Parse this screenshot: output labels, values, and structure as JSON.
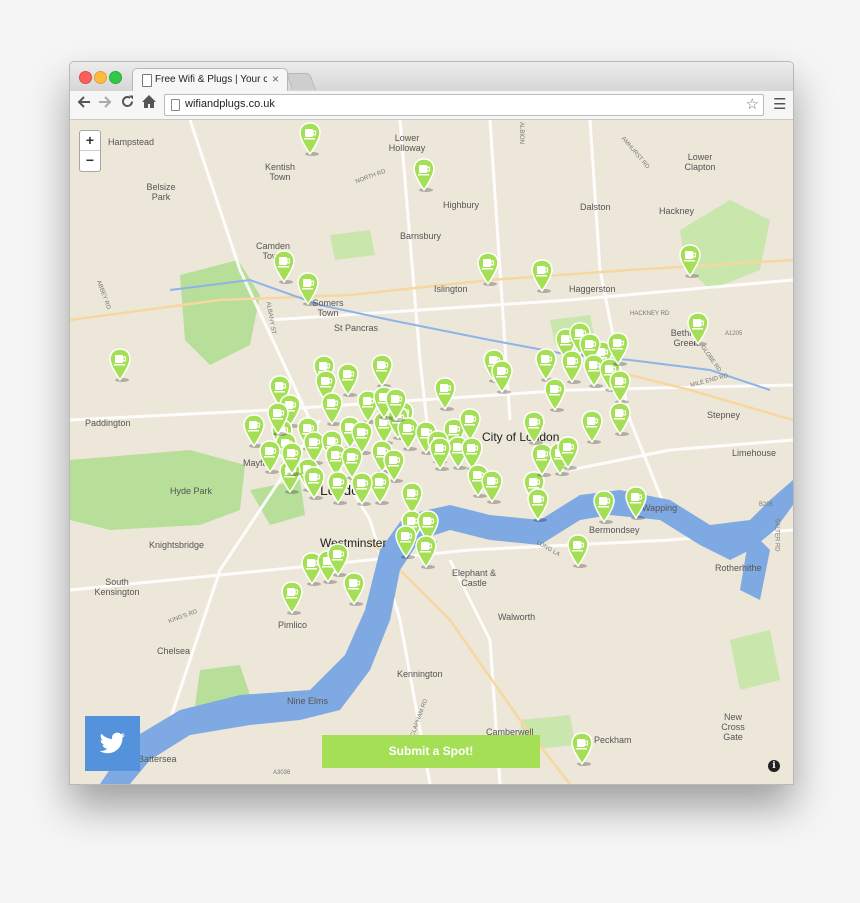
{
  "browser": {
    "tab_title": "Free Wifi & Plugs | Your co",
    "tab_close": "×",
    "url": "wifiandplugs.co.uk",
    "icons": [
      "back-arrow-icon",
      "forward-arrow-icon",
      "reload-icon",
      "home-icon",
      "page-icon",
      "bookmark-star-icon",
      "menu-icon"
    ]
  },
  "map": {
    "zoom_in": "+",
    "zoom_out": "−",
    "submit_label": "Submit a Spot!",
    "info": "i",
    "colors": {
      "park": "#b8df9a",
      "water": "#7fa9e3",
      "land": "#ede7da",
      "pin": "#a5df55",
      "twitter": "#5592dc"
    },
    "places": [
      {
        "name": "Hampstead",
        "size": "small"
      },
      {
        "name": "Kentish Town",
        "size": "small"
      },
      {
        "name": "Belsize Park",
        "size": "small"
      },
      {
        "name": "Camden Town",
        "size": "small"
      },
      {
        "name": "Highbury",
        "size": "small"
      },
      {
        "name": "Barnsbury",
        "size": "small"
      },
      {
        "name": "Dalston",
        "size": "small"
      },
      {
        "name": "Hackney",
        "size": "small"
      },
      {
        "name": "Lower Clapton",
        "size": "small"
      },
      {
        "name": "Islington",
        "size": "small"
      },
      {
        "name": "Haggerston",
        "size": "small"
      },
      {
        "name": "Somers Town",
        "size": "small"
      },
      {
        "name": "St Pancras",
        "size": "small"
      },
      {
        "name": "Bethnal Green",
        "size": "small"
      },
      {
        "name": "Paddington",
        "size": "small"
      },
      {
        "name": "Stepney",
        "size": "small"
      },
      {
        "name": "City of London",
        "size": "mid"
      },
      {
        "name": "Limehouse",
        "size": "small"
      },
      {
        "name": "Mayfair",
        "size": "small"
      },
      {
        "name": "London",
        "size": "big"
      },
      {
        "name": "Hyde Park",
        "size": "small"
      },
      {
        "name": "Wapping",
        "size": "small"
      },
      {
        "name": "Knightsbridge",
        "size": "small"
      },
      {
        "name": "Westminster",
        "size": "mid"
      },
      {
        "name": "Bermondsey",
        "size": "small"
      },
      {
        "name": "South Kensington",
        "size": "small"
      },
      {
        "name": "Rotherhithe",
        "size": "small"
      },
      {
        "name": "Elephant & Castle",
        "size": "small"
      },
      {
        "name": "Pimlico",
        "size": "small"
      },
      {
        "name": "Walworth",
        "size": "small"
      },
      {
        "name": "Chelsea",
        "size": "small"
      },
      {
        "name": "Kennington",
        "size": "small"
      },
      {
        "name": "Nine Elms",
        "size": "small"
      },
      {
        "name": "Camberwell",
        "size": "small"
      },
      {
        "name": "Peckham",
        "size": "small"
      },
      {
        "name": "New Cross Gate",
        "size": "small"
      },
      {
        "name": "Battersea",
        "size": "small"
      },
      {
        "name": "Lower Holloway",
        "size": "small"
      }
    ],
    "roads": [
      "NORTH RD",
      "ALBION",
      "AMHURST RD",
      "ABBEY RD",
      "ALBANY ST",
      "HACKNEY RD",
      "A1205",
      "GLOBE RD",
      "MILE END RD",
      "SALTER RD",
      "B205",
      "LONG LA",
      "KING'S RD",
      "A3036",
      "CLAPHAM RD"
    ]
  }
}
